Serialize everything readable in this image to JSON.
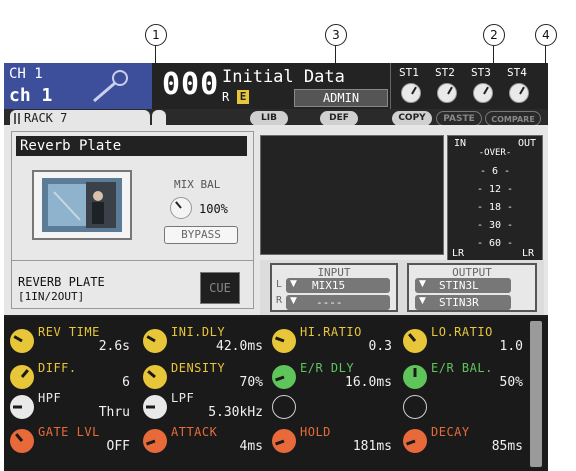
{
  "callouts": [
    "1",
    "3",
    "2",
    "4"
  ],
  "header": {
    "ch_number": "CH 1",
    "ch_name": "ch 1",
    "scene_number": "000",
    "scene_title": "Initial Data",
    "scene_flag_r": "R",
    "scene_flag_e": "E",
    "user": "ADMIN",
    "st_labels": [
      "ST1",
      "ST2",
      "ST3",
      "ST4"
    ]
  },
  "tabs": {
    "rack": "RACK 7"
  },
  "toolbar": {
    "lib": "LIB",
    "def": "DEF",
    "copy": "COPY",
    "paste": "PASTE",
    "compare": "COMPARE"
  },
  "effect": {
    "name": "Reverb Plate",
    "mix_label": "MIX BAL",
    "mix_value": "100%",
    "bypass": "BYPASS",
    "type_line1": "REVERB PLATE",
    "type_line2": "[1IN/2OUT]",
    "cue": "CUE"
  },
  "meter": {
    "in": "IN",
    "out": "OUT",
    "scale": [
      "-OVER-",
      "- 6 -",
      "- 12 -",
      "- 18 -",
      "- 30 -",
      "- 60 -"
    ],
    "lr_left": "LR",
    "lr_right": "LR"
  },
  "routing": {
    "input_title": "INPUT",
    "input_l_label": "L",
    "input_r_label": "R",
    "input_l": "MIX15",
    "input_r": "----",
    "output_title": "OUTPUT",
    "output_1": "STIN3L",
    "output_2": "STIN3R"
  },
  "params": [
    {
      "name": "REV TIME",
      "value": "2.6s",
      "color": "#e8c63a"
    },
    {
      "name": "INI.DLY",
      "value": "42.0ms",
      "color": "#e8c63a"
    },
    {
      "name": "HI.RATIO",
      "value": "0.3",
      "color": "#e8c63a"
    },
    {
      "name": "LO.RATIO",
      "value": "1.0",
      "color": "#e8c63a"
    },
    {
      "name": "DIFF.",
      "value": "6",
      "color": "#e8c63a"
    },
    {
      "name": "DENSITY",
      "value": "70%",
      "color": "#e8c63a"
    },
    {
      "name": "E/R DLY",
      "value": "16.0ms",
      "color": "#5fc45a"
    },
    {
      "name": "E/R BAL.",
      "value": "50%",
      "color": "#5fc45a"
    },
    {
      "name": "HPF",
      "value": "Thru",
      "color": "#e9e9e9"
    },
    {
      "name": "LPF",
      "value": "5.30kHz",
      "color": "#e9e9e9"
    },
    {
      "name": "GATE LVL",
      "value": "OFF",
      "color": "#e86a3a"
    },
    {
      "name": "ATTACK",
      "value": "4ms",
      "color": "#e86a3a"
    },
    {
      "name": "HOLD",
      "value": "181ms",
      "color": "#e86a3a"
    },
    {
      "name": "DECAY",
      "value": "85ms",
      "color": "#e86a3a"
    }
  ]
}
